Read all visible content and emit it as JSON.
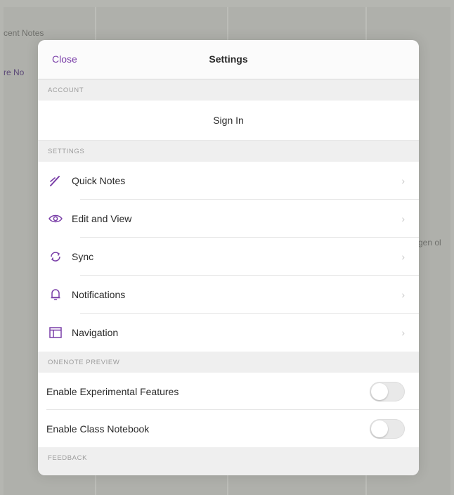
{
  "background": {
    "text_recent": "cent Notes",
    "text_more": "re No",
    "text_side": "gen ol"
  },
  "dialog": {
    "close_label": "Close",
    "title": "Settings",
    "sections": {
      "account_header": "ACCOUNT",
      "sign_in_label": "Sign In",
      "settings_header": "SETTINGS",
      "preview_header": "ONENOTE PREVIEW",
      "feedback_header": "FEEDBACK"
    },
    "settings_items": [
      {
        "label": "Quick Notes",
        "icon": "pen-icon"
      },
      {
        "label": "Edit and View",
        "icon": "eye-icon"
      },
      {
        "label": "Sync",
        "icon": "sync-icon"
      },
      {
        "label": "Notifications",
        "icon": "bell-icon"
      },
      {
        "label": "Navigation",
        "icon": "navigation-pane-icon"
      }
    ],
    "chevron": "›",
    "toggles": [
      {
        "label": "Enable Experimental Features",
        "on": false
      },
      {
        "label": "Enable Class Notebook",
        "on": false
      }
    ]
  },
  "colors": {
    "accent": "#7a3fa8",
    "backdrop": "#b5b6b1"
  }
}
